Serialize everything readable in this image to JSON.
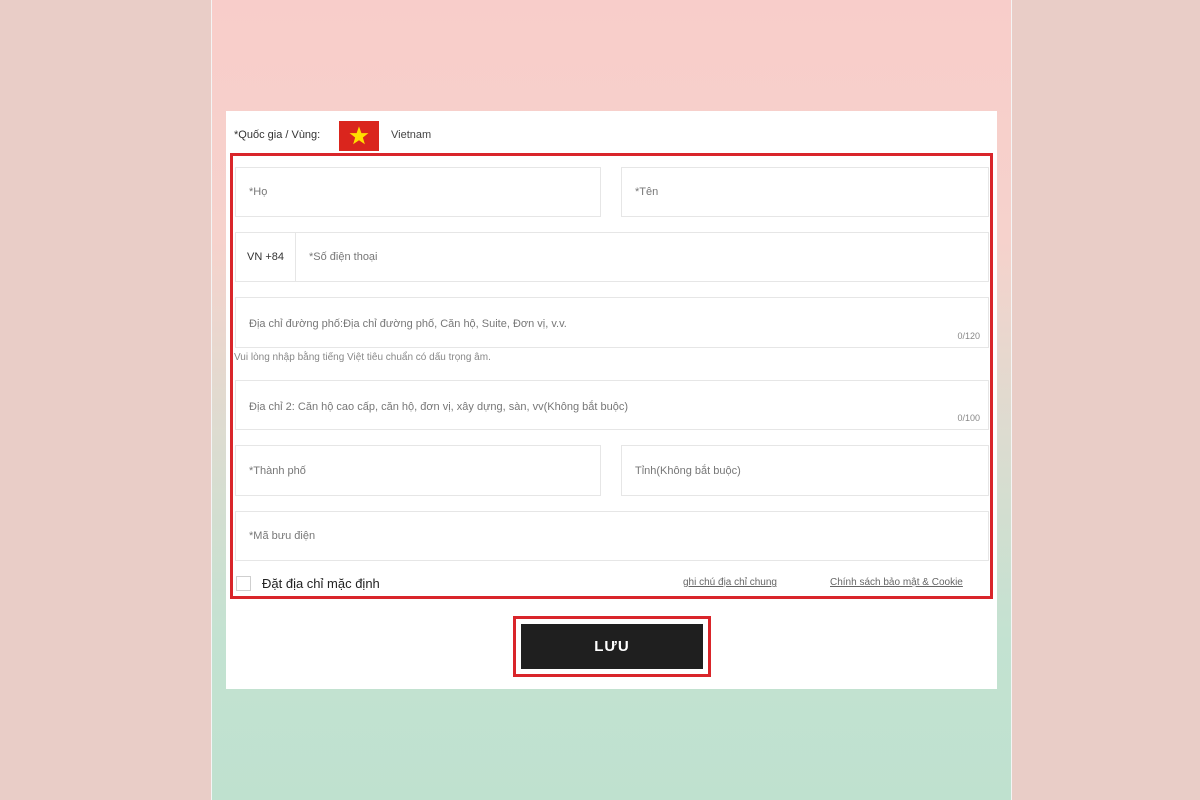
{
  "country": {
    "label": "*Quốc gia / Vùng:",
    "value": "Vietnam",
    "flag_color": "#da251d",
    "flag_star_color": "#ffde00",
    "flag_icon": "vietnam-flag-icon"
  },
  "form": {
    "last_name_placeholder": "*Họ",
    "first_name_placeholder": "*Tên",
    "phone_prefix": "VN +84",
    "phone_placeholder": "*Số điện thoại",
    "street_placeholder": "Địa chỉ đường phố:Địa chỉ đường phố, Căn hộ, Suite, Đơn vị, v.v.",
    "street_counter": "0/120",
    "street_hint": "Vui lòng nhập bằng tiếng Việt tiêu chuẩn có dấu trọng âm.",
    "address2_placeholder": "Địa chỉ 2: Căn hộ cao cấp, căn hộ, đơn vị, xây dựng, sàn, vv(Không bắt buộc)",
    "address2_counter": "0/100",
    "city_placeholder": "*Thành phố",
    "province_placeholder": "Tỉnh(Không bắt buộc)",
    "postal_placeholder": "*Mã bưu điện",
    "default_address_label": "Đặt địa chỉ mặc định",
    "address_note_link": "ghi chú địa chỉ chung",
    "privacy_link": "Chính sách bảo mật & Cookie"
  },
  "actions": {
    "save_label": "LƯU"
  },
  "colors": {
    "highlight": "#d9252a",
    "save_button_bg": "#1f1f1f"
  }
}
